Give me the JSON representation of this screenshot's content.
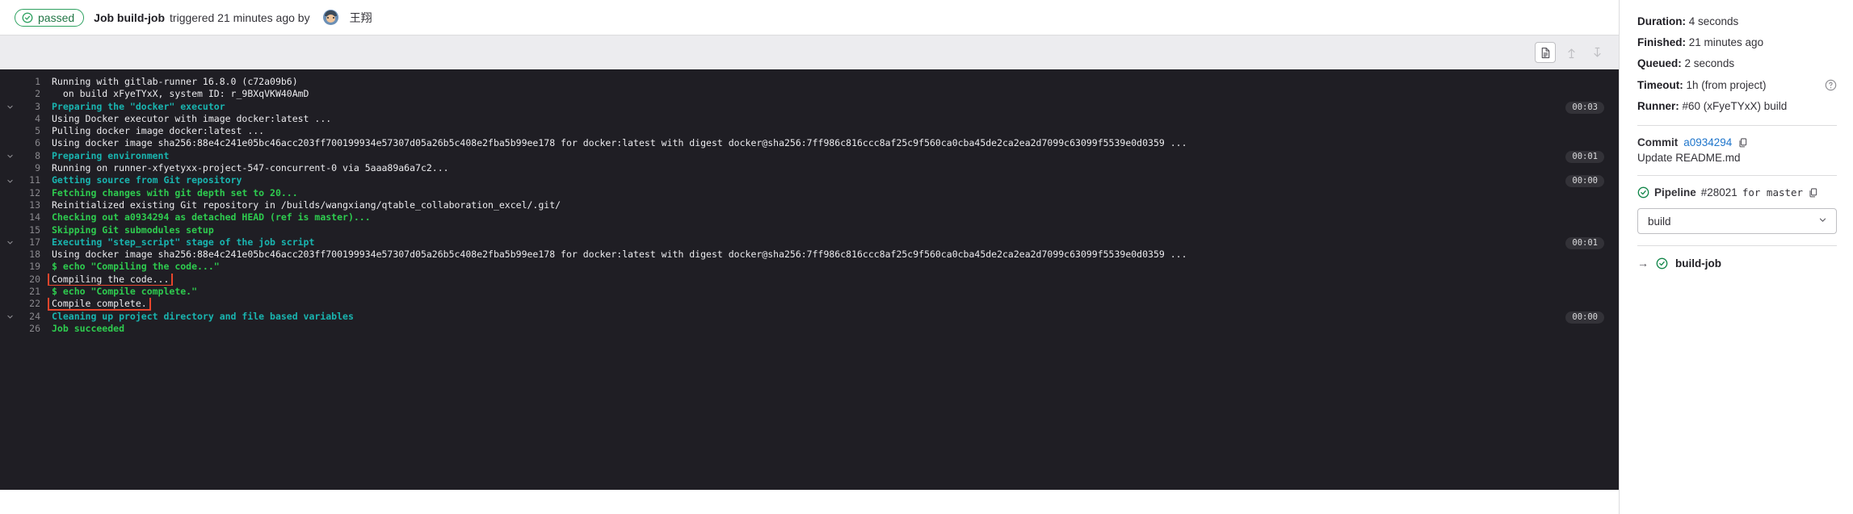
{
  "header": {
    "status_label": "passed",
    "status_icon": "check-circle-icon",
    "job_title": "Job build-job",
    "triggered_text": "triggered 21 minutes ago by",
    "username": "王翔"
  },
  "toolbar": {
    "show_complete_raw": "file-icon",
    "scroll_top": "arrow-up-icon",
    "scroll_bottom": "arrow-down-icon"
  },
  "log": {
    "lines": [
      {
        "n": "1",
        "chev": false,
        "color": "default",
        "text": "Running with gitlab-runner 16.8.0 (c72a09b6)",
        "badge": ""
      },
      {
        "n": "2",
        "chev": false,
        "color": "default",
        "text": "  on build xFyeTYxX, system ID: r_9BXqVKW40AmD",
        "badge": ""
      },
      {
        "n": "3",
        "chev": true,
        "color": "cyan",
        "text": "Preparing the \"docker\" executor",
        "badge": "00:03"
      },
      {
        "n": "4",
        "chev": false,
        "color": "default",
        "text": "Using Docker executor with image docker:latest ...",
        "badge": ""
      },
      {
        "n": "5",
        "chev": false,
        "color": "default",
        "text": "Pulling docker image docker:latest ...",
        "badge": ""
      },
      {
        "n": "6",
        "chev": false,
        "color": "default",
        "text": "Using docker image sha256:88e4c241e05bc46acc203ff700199934e57307d05a26b5c408e2fba5b99ee178 for docker:latest with digest docker@sha256:7ff986c816ccc8af25c9f560ca0cba45de2ca2ea2d7099c63099f5539e0d0359 ...",
        "badge": ""
      },
      {
        "n": "8",
        "chev": true,
        "color": "cyan",
        "text": "Preparing environment",
        "badge": "00:01"
      },
      {
        "n": "9",
        "chev": false,
        "color": "default",
        "text": "Running on runner-xfyetyxx-project-547-concurrent-0 via 5aaa89a6a7c2...",
        "badge": ""
      },
      {
        "n": "11",
        "chev": true,
        "color": "cyan",
        "text": "Getting source from Git repository",
        "badge": "00:00"
      },
      {
        "n": "12",
        "chev": false,
        "color": "green",
        "text": "Fetching changes with git depth set to 20...",
        "badge": ""
      },
      {
        "n": "13",
        "chev": false,
        "color": "default",
        "text": "Reinitialized existing Git repository in /builds/wangxiang/qtable_collaboration_excel/.git/",
        "badge": ""
      },
      {
        "n": "14",
        "chev": false,
        "color": "green",
        "text": "Checking out a0934294 as detached HEAD (ref is master)...",
        "badge": ""
      },
      {
        "n": "15",
        "chev": false,
        "color": "green",
        "text": "Skipping Git submodules setup",
        "badge": ""
      },
      {
        "n": "17",
        "chev": true,
        "color": "cyan",
        "text": "Executing \"step_script\" stage of the job script",
        "badge": "00:01"
      },
      {
        "n": "18",
        "chev": false,
        "color": "default",
        "text": "Using docker image sha256:88e4c241e05bc46acc203ff700199934e57307d05a26b5c408e2fba5b99ee178 for docker:latest with digest docker@sha256:7ff986c816ccc8af25c9f560ca0cba45de2ca2ea2d7099c63099f5539e0d0359 ...",
        "badge": ""
      },
      {
        "n": "19",
        "chev": false,
        "color": "green",
        "text": "$ echo \"Compiling the code...\"",
        "badge": ""
      },
      {
        "n": "20",
        "chev": false,
        "color": "default",
        "text": "Compiling the code...",
        "badge": "",
        "boxed": true
      },
      {
        "n": "21",
        "chev": false,
        "color": "green",
        "text": "$ echo \"Compile complete.\"",
        "badge": ""
      },
      {
        "n": "22",
        "chev": false,
        "color": "default",
        "text": "Compile complete.",
        "badge": "",
        "boxed": true
      },
      {
        "n": "24",
        "chev": true,
        "color": "cyan",
        "text": "Cleaning up project directory and file based variables",
        "badge": "00:00"
      },
      {
        "n": "26",
        "chev": false,
        "color": "green",
        "text": "Job succeeded",
        "badge": ""
      }
    ]
  },
  "sidebar": {
    "duration_label": "Duration:",
    "duration_value": "4 seconds",
    "finished_label": "Finished:",
    "finished_value": "21 minutes ago",
    "queued_label": "Queued:",
    "queued_value": "2 seconds",
    "timeout_label": "Timeout:",
    "timeout_value": "1h (from project)",
    "runner_label": "Runner:",
    "runner_value": "#60 (xFyeTYxX) build",
    "commit_label": "Commit",
    "commit_sha": "a0934294",
    "commit_message": "Update README.md",
    "pipeline_label": "Pipeline",
    "pipeline_id": "#28021",
    "pipeline_ref_text": "for master",
    "stage_selected": "build",
    "job_name": "build-job",
    "accent_link": "#1f75cb",
    "accent_success": "#108548"
  }
}
